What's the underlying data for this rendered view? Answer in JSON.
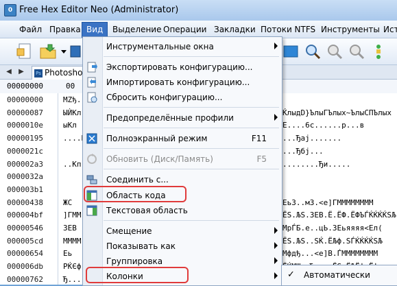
{
  "window": {
    "title": "Free Hex Editor Neo (Administrator)"
  },
  "menubar": {
    "items": [
      "Файл",
      "Правка",
      "Вид",
      "Выделение",
      "Операции",
      "Закладки",
      "Потоки NTFS",
      "Инструменты",
      "Ист"
    ]
  },
  "tabbar": {
    "doc_tab": "Photoshop"
  },
  "hexhead": {
    "offset": "00000000",
    "col": "00"
  },
  "offsets": [
    "00000000",
    "00000087",
    "0000010e",
    "00000195",
    "0000021c",
    "000002a3",
    "0000032a",
    "000003b1",
    "00000438",
    "000004bf",
    "00000546",
    "000005cd",
    "00000654",
    "000006db",
    "00000762"
  ],
  "hex_left": [
    "MZђ.",
    "ЫЍКл",
    "ыКл",
    "....Б",
    "",
    "..Кп",
    "",
    "",
    "ЖС",
    "]ГММ",
    "ЗЕВ",
    "ММММ",
    "Еь",
    "РЌЄф",
    "Ђ....."
  ],
  "hex_right": [
    "",
    "ЌлыдD}ЪлыГЪлых~ЪлыСПЪлых",
    "E....6с......р...в",
    "...Ђај.......",
    "...Ђбј...",
    "........Ђи.....",
    "",
    "",
    "ЕьЗ..мЗ.<е]ГММММММММ",
    "ЁЅ.ЉЅ.ЗЕВ.Ё.ЁФ.ЁФЪЃЌЌЌЌЅЉ",
    "МрЃБ.е..цЬ.ЗЕьяяяя<Ел(",
    "ЁЅ.ЉЅ..ЅЌ.ЁЉф.ЅЃЌЌЌЌЅЉ",
    "Мфдђ...<е]В.ЃММММММММ",
    "ЁЌМШл.Ђц...ЁЅ«ЁЉЁф.Ёф",
    "Е...рЅЉЁЈ.....ЖЖЖЁЅ"
  ],
  "view_menu": {
    "items": [
      {
        "label": "Инструментальные окна",
        "submenu": true,
        "icon": "none"
      },
      {
        "label": "Экспортировать конфигурацию...",
        "icon": "export-config-icon"
      },
      {
        "label": "Импортировать конфигурацию...",
        "icon": "import-config-icon"
      },
      {
        "label": "Сбросить конфигурацию...",
        "icon": "reset-config-icon"
      },
      {
        "label": "Предопределённые профили",
        "submenu": true,
        "icon": "none"
      },
      {
        "label": "Полноэкранный режим",
        "shortcut": "F11",
        "icon": "fullscreen-icon"
      },
      {
        "label": "Обновить (Диск/Память)",
        "shortcut": "F5",
        "disabled": true,
        "icon": "refresh-icon"
      },
      {
        "label": "Соединить с...",
        "icon": "link-icon"
      },
      {
        "label": "Область кода",
        "icon": "code-area-icon"
      },
      {
        "label": "Текстовая область",
        "icon": "text-area-icon"
      },
      {
        "label": "Смещение",
        "submenu": true,
        "icon": "none"
      },
      {
        "label": "Показывать как",
        "submenu": true,
        "icon": "none"
      },
      {
        "label": "Группировка",
        "submenu": true,
        "icon": "none"
      },
      {
        "label": "Колонки",
        "submenu": true,
        "icon": "none"
      }
    ]
  },
  "columns_submenu": {
    "check": "✓",
    "label": "Автоматически"
  },
  "colors": {
    "accent": "#3a73c4",
    "highlight_ring": "#e03b3b"
  }
}
